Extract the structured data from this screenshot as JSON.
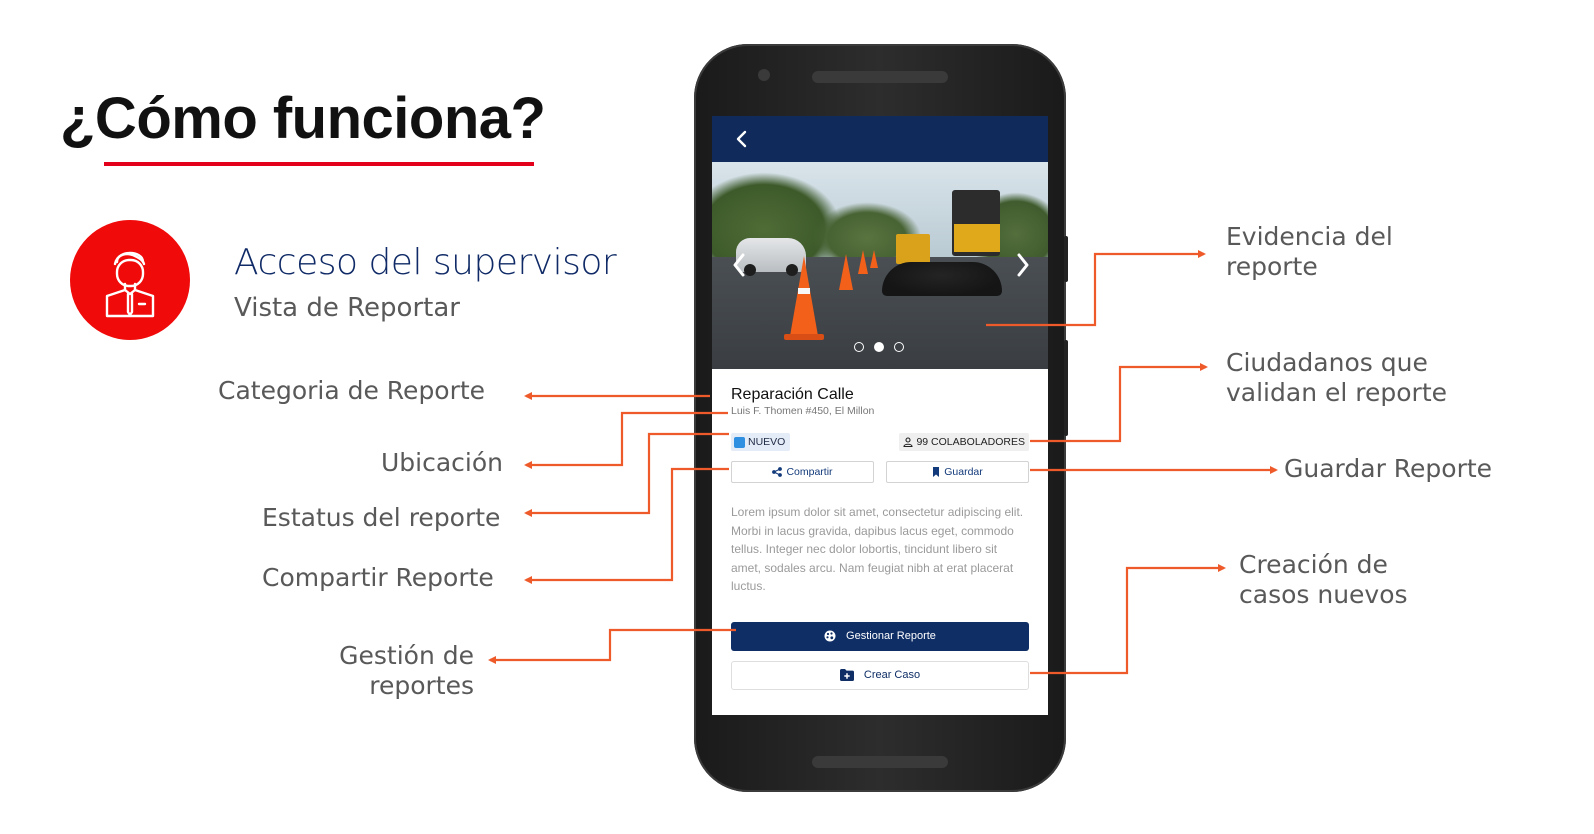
{
  "slide": {
    "title": "¿Cómo funciona?",
    "role_title": "Acceso del supervisor",
    "role_subtitle": "Vista de Reportar"
  },
  "labels": {
    "categoria": "Categoria de Reporte",
    "ubicacion": "Ubicación",
    "estatus": "Estatus del reporte",
    "compartir": "Compartir Reporte",
    "gestion_1": "Gestión de",
    "gestion_2": "reportes",
    "evidencia_1": "Evidencia del",
    "evidencia_2": "reporte",
    "ciudadanos_1": "Ciudadanos que",
    "ciudadanos_2": "validan el reporte",
    "guardar": "Guardar Reporte",
    "creacion_1": "Creación de",
    "creacion_2": "casos nuevos"
  },
  "app": {
    "report_title": "Reparación Calle",
    "report_address": "Luis F. Thomen #450, El Millon",
    "status": "NUEVO",
    "collaborators": "99 COLABOLADORES",
    "share_label": "Compartir",
    "save_label": "Guardar",
    "description": "Lorem ipsum dolor sit amet, consectetur adipiscing elit. Morbi in lacus gravida, dapibus lacus eget, commodo tellus. Integer nec dolor lobortis, tincidunt libero sit amet, sodales arcu. Nam feugiat nibh at erat placerat luctus.",
    "manage_label": "Gestionar Reporte",
    "create_case_label": "Crear Caso",
    "carousel_pages": 3,
    "carousel_active": 2
  },
  "colors": {
    "accent_red": "#e3001b",
    "callout_line": "#ee5a2a",
    "navy": "#0f2a5b",
    "status_blue": "#2f8fe0"
  },
  "icons": [
    "supervisor-icon",
    "back-icon",
    "chevron-left-icon",
    "chevron-right-icon",
    "share-icon",
    "bookmark-icon",
    "user-icon",
    "palette-icon",
    "folder-plus-icon"
  ]
}
